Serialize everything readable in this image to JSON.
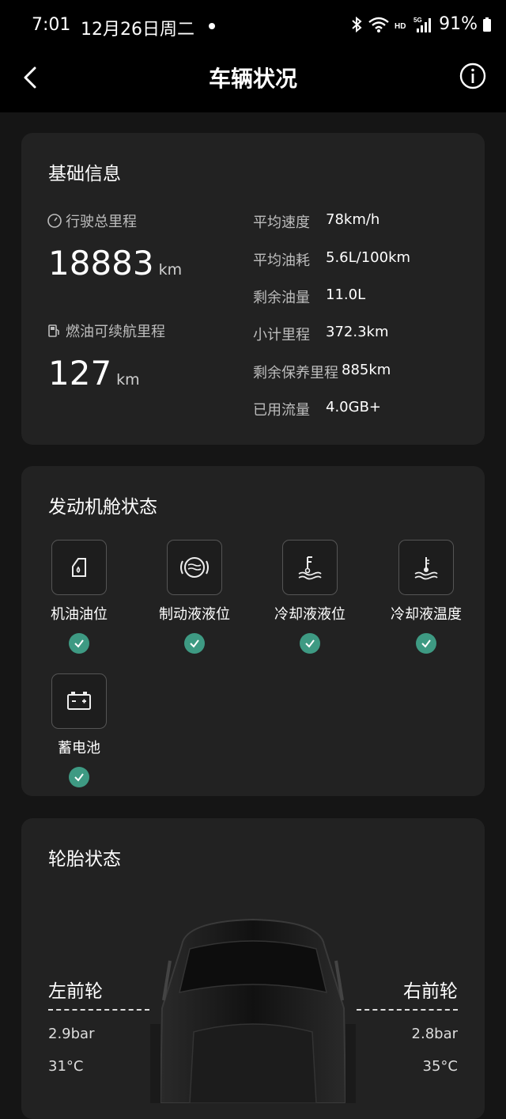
{
  "status_bar": {
    "time": "7:01",
    "date": "12月26日周二",
    "battery": "91%",
    "icons": [
      "bluetooth-icon",
      "wifi-icon",
      "hd-icon",
      "signal-5g-icon",
      "battery-icon"
    ]
  },
  "nav": {
    "title": "车辆状况",
    "icons": [
      "back-icon",
      "info-icon"
    ]
  },
  "basic_info": {
    "title": "基础信息",
    "total_mileage": {
      "label": "行驶总里程",
      "value": "18883",
      "unit": "km"
    },
    "fuel_range": {
      "label": "燃油可续航里程",
      "value": "127",
      "unit": "km"
    },
    "stats": [
      {
        "label": "平均速度",
        "value": "78km/h"
      },
      {
        "label": "平均油耗",
        "value": "5.6L/100km"
      },
      {
        "label": "剩余油量",
        "value": "11.0L"
      },
      {
        "label": "小计里程",
        "value": "372.3km"
      },
      {
        "label": "剩余保养里程",
        "value": "885km"
      },
      {
        "label": "已用流量",
        "value": "4.0GB+"
      }
    ]
  },
  "engine": {
    "title": "发动机舱状态",
    "items": [
      {
        "label": "机油油位",
        "icon": "oil-level-icon",
        "status": "ok"
      },
      {
        "label": "制动液液位",
        "icon": "brake-fluid-icon",
        "status": "ok"
      },
      {
        "label": "冷却液液位",
        "icon": "coolant-level-icon",
        "status": "ok"
      },
      {
        "label": "冷却液温度",
        "icon": "coolant-temp-icon",
        "status": "ok"
      },
      {
        "label": "蓄电池",
        "icon": "battery-icon",
        "status": "ok"
      }
    ]
  },
  "tire": {
    "title": "轮胎状态",
    "front_left": {
      "label": "左前轮",
      "pressure": "2.9bar",
      "temp": "31°C"
    },
    "front_right": {
      "label": "右前轮",
      "pressure": "2.8bar",
      "temp": "35°C"
    }
  },
  "colors": {
    "accent": "#3e9a83",
    "card": "#222222",
    "background": "#151515"
  }
}
